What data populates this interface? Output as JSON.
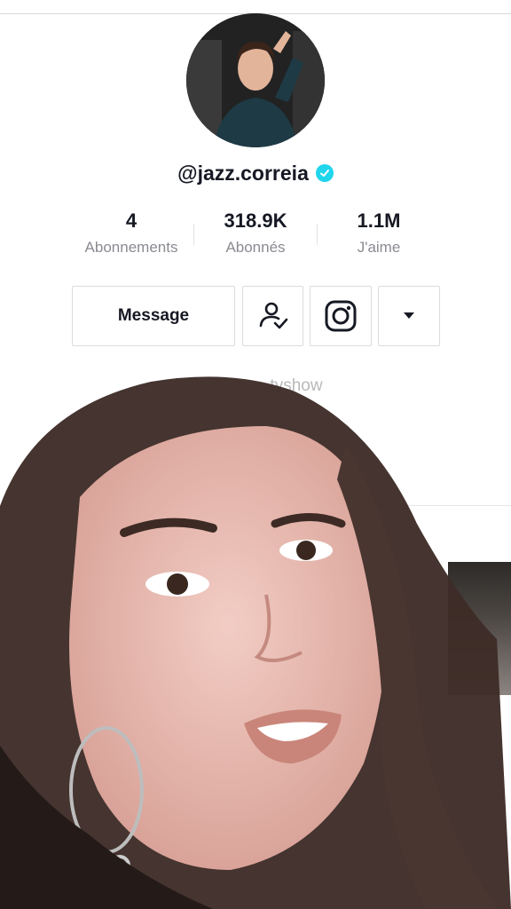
{
  "profile": {
    "username": "@jazz.correia",
    "verified": true,
    "accent_color": "#20d5ec"
  },
  "stats": [
    {
      "value": "4",
      "label": "Abonnements"
    },
    {
      "value": "318.9K",
      "label": "Abonnés"
    },
    {
      "value": "1.1M",
      "label": "J'aime"
    }
  ],
  "actions": {
    "message_label": "Message",
    "follow_icon": "user-check-icon",
    "instagram_icon": "instagram-icon",
    "more_icon": "caret-down-icon"
  },
  "bio": {
    "line1": "tyshow"
  }
}
